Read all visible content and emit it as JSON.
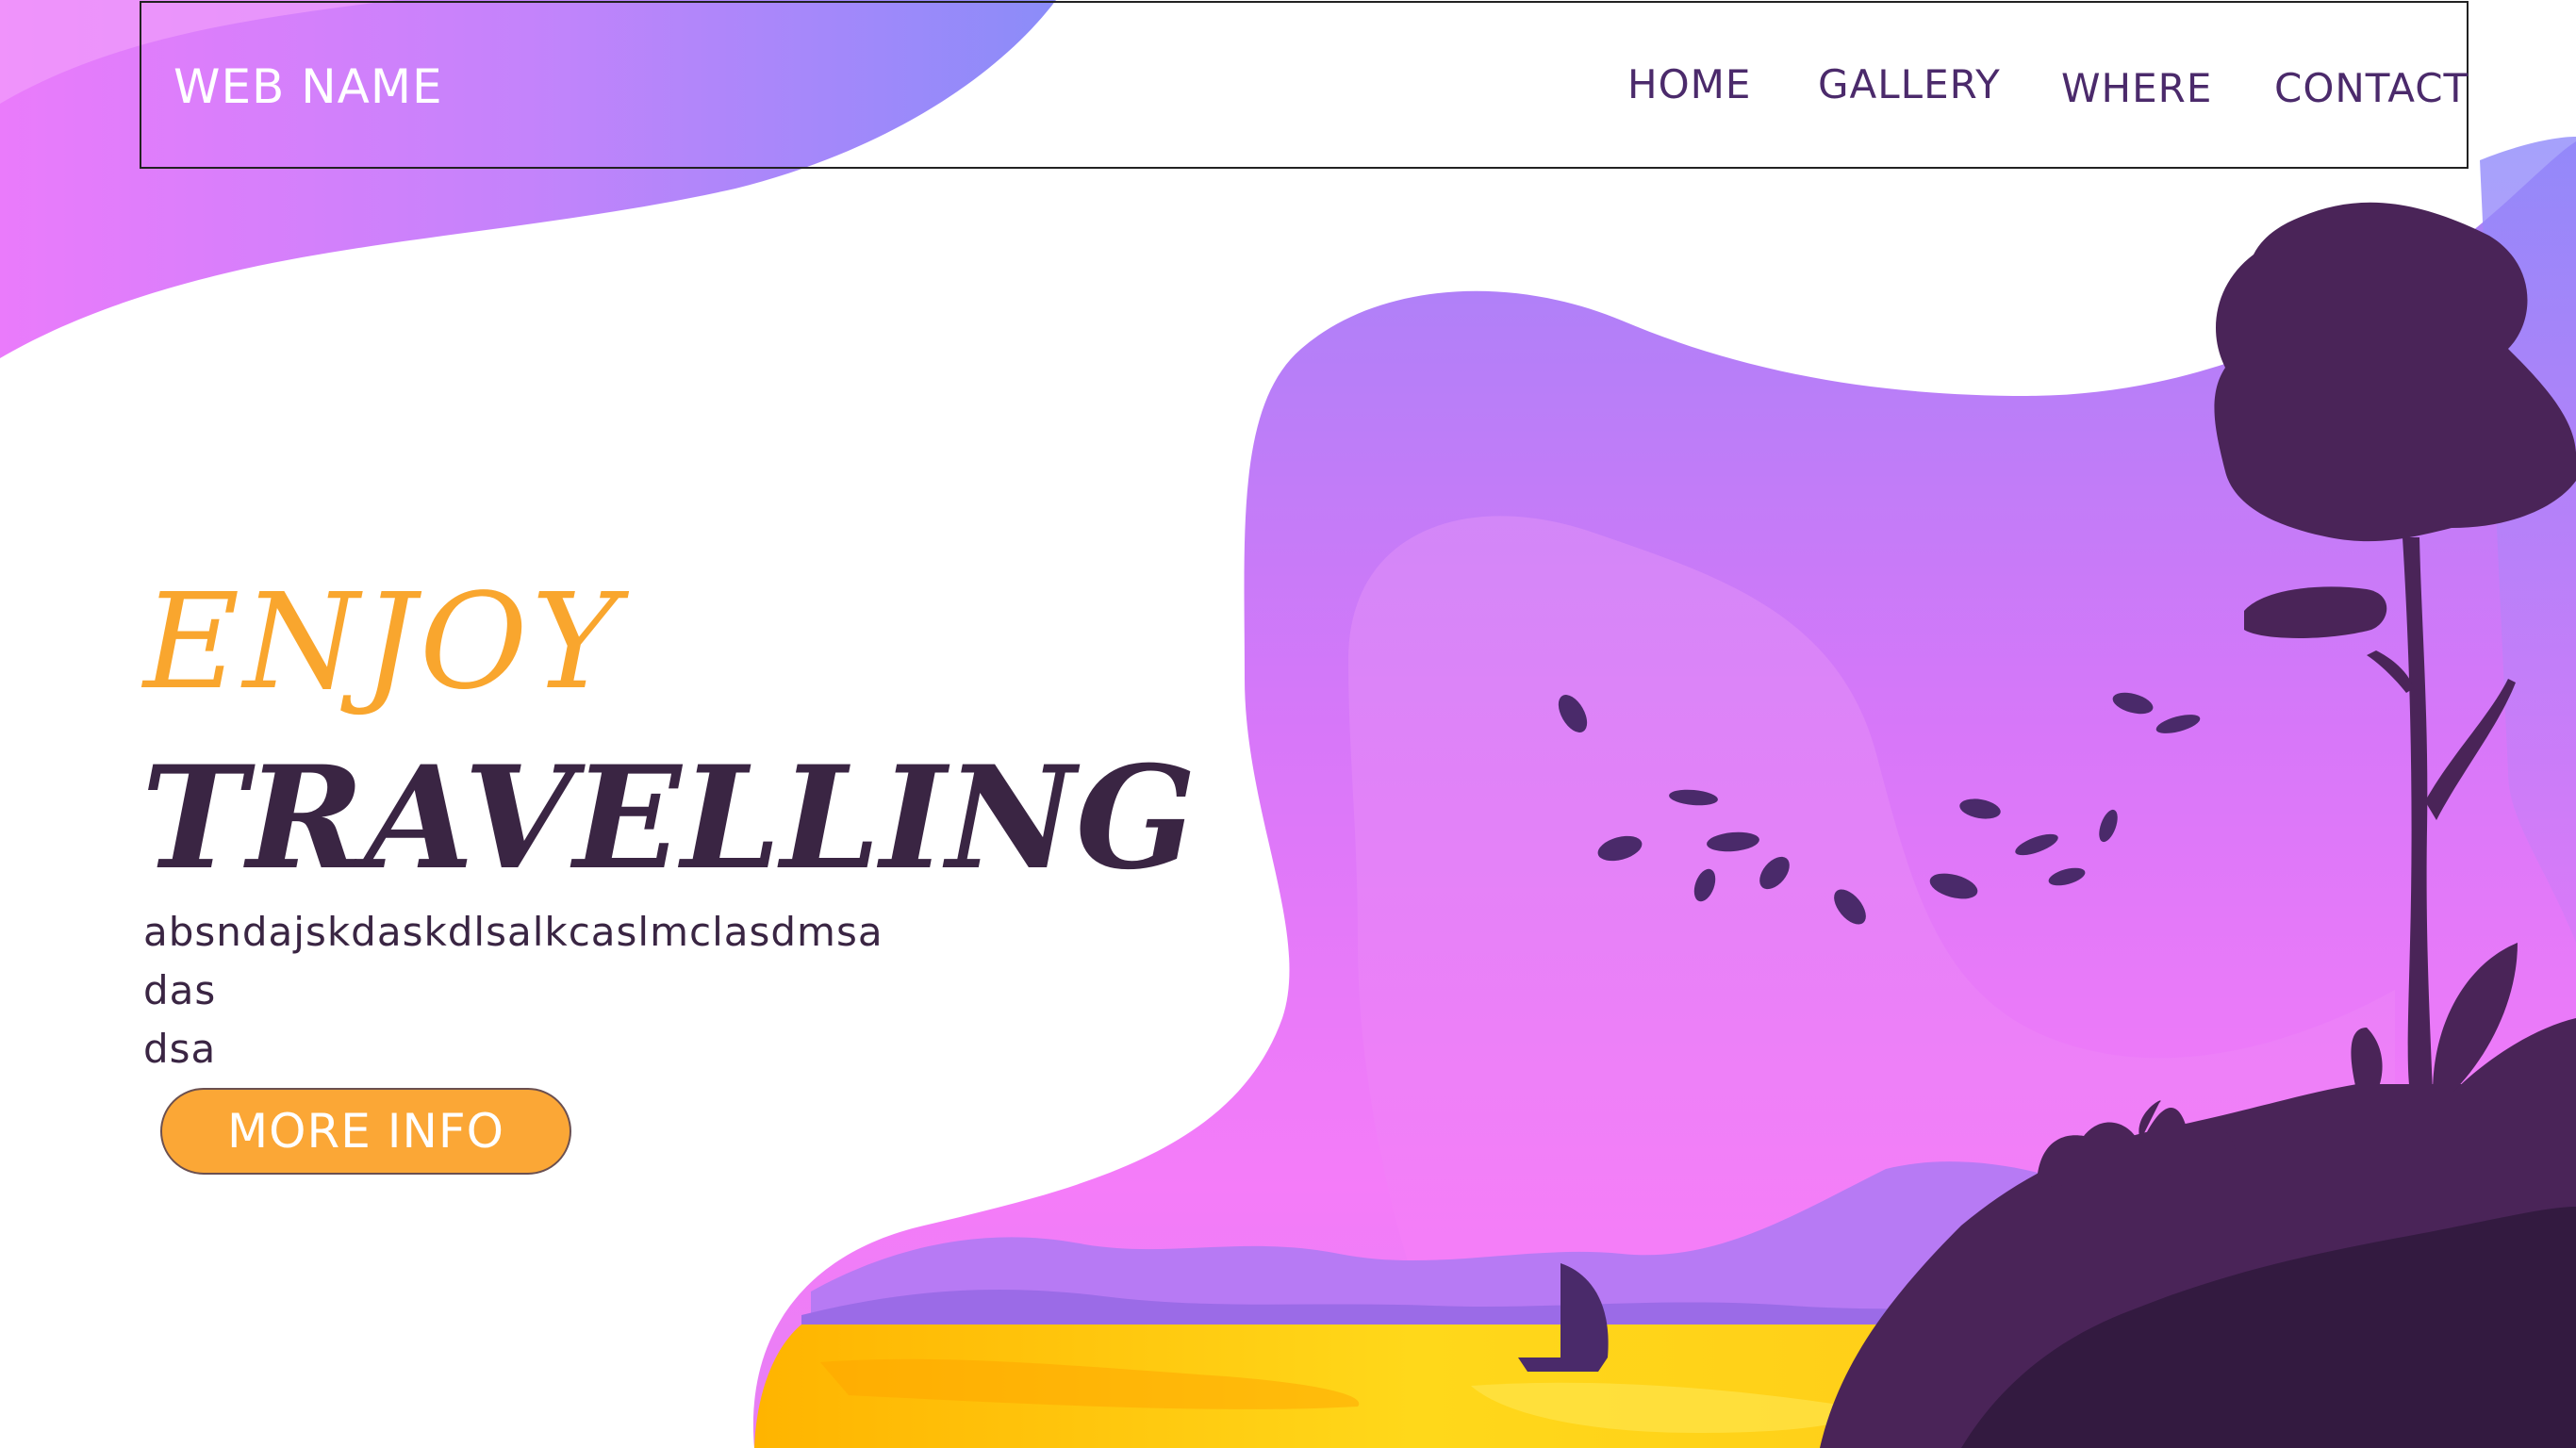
{
  "nav": {
    "brand": "WEB NAME",
    "items": [
      {
        "label": "HOME"
      },
      {
        "label": "GALLERY"
      },
      {
        "label": "WHERE"
      },
      {
        "label": "CONTACT"
      }
    ]
  },
  "hero": {
    "title_line1": "ENJOY",
    "title_line2": "TRAVELLING",
    "description_lines": [
      "absndajskdaskdlsalkcaslmclasdmsa",
      "das",
      "dsa"
    ],
    "cta_label": "MORE INFO"
  },
  "colors": {
    "accent_orange": "#fba736",
    "dark_purple": "#3a2543",
    "nav_text": "#4b2a6b",
    "gradient_pink": "#f27cf9",
    "gradient_violet": "#9b88fb"
  }
}
